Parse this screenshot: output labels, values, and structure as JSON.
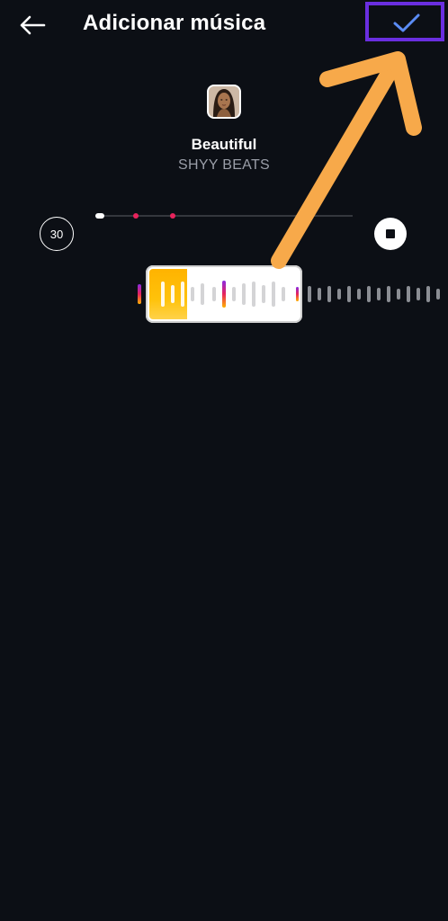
{
  "header": {
    "title": "Adicionar música"
  },
  "track": {
    "title": "Beautiful",
    "artist": "SHYY BEATS"
  },
  "controls": {
    "duration": "30"
  },
  "colors": {
    "background": "#0c0f15",
    "accent_check": "#5b8cf5",
    "highlight_box": "#6a2ee0",
    "annotation_arrow": "#f7a94a",
    "marker": "#e8235c"
  },
  "icons": {
    "back": "back-arrow-icon",
    "confirm": "check-icon",
    "stop": "stop-icon"
  }
}
